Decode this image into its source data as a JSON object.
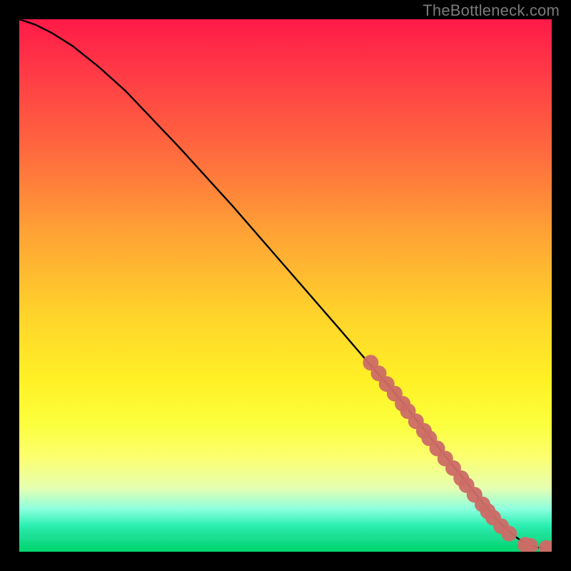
{
  "watermark": "TheBottleneck.com",
  "colors": {
    "page_bg": "#000000",
    "curve": "#000000",
    "marker_fill": "#cc6b66",
    "marker_stroke": "#cc6b66"
  },
  "chart_data": {
    "type": "line",
    "title": "",
    "xlabel": "",
    "ylabel": "",
    "xlim": [
      0,
      100
    ],
    "ylim": [
      0,
      100
    ],
    "grid": false,
    "legend": false,
    "series": [
      {
        "name": "curve",
        "x": [
          0,
          3,
          6,
          10,
          15,
          20,
          30,
          40,
          50,
          60,
          66,
          70,
          72,
          74,
          76,
          78,
          80,
          82,
          84,
          86,
          88,
          89,
          90,
          91.5,
          92.5,
          93.5,
          95,
          97,
          98,
          100
        ],
        "y": [
          100,
          99,
          97.5,
          95,
          91,
          86.5,
          76,
          65,
          53.5,
          42,
          35,
          30.5,
          28,
          25.5,
          23,
          20.5,
          18,
          15.5,
          13,
          10.5,
          8,
          6.8,
          5.6,
          4.3,
          3.4,
          2.6,
          1.6,
          0.9,
          0.7,
          0.6
        ]
      }
    ],
    "markers": [
      {
        "x": 66.0,
        "y": 35.5
      },
      {
        "x": 67.5,
        "y": 33.5
      },
      {
        "x": 69.0,
        "y": 31.5
      },
      {
        "x": 70.5,
        "y": 29.7
      },
      {
        "x": 72.0,
        "y": 27.8
      },
      {
        "x": 73.0,
        "y": 26.4
      },
      {
        "x": 74.5,
        "y": 24.5
      },
      {
        "x": 76.0,
        "y": 22.7
      },
      {
        "x": 77.0,
        "y": 21.3
      },
      {
        "x": 78.5,
        "y": 19.4
      },
      {
        "x": 80.0,
        "y": 17.5
      },
      {
        "x": 81.5,
        "y": 15.7
      },
      {
        "x": 83.0,
        "y": 13.8
      },
      {
        "x": 84.0,
        "y": 12.5
      },
      {
        "x": 85.5,
        "y": 10.7
      },
      {
        "x": 87.0,
        "y": 8.9
      },
      {
        "x": 88.0,
        "y": 7.6
      },
      {
        "x": 89.0,
        "y": 6.4
      },
      {
        "x": 90.5,
        "y": 4.8
      },
      {
        "x": 92.0,
        "y": 3.4
      },
      {
        "x": 95.0,
        "y": 1.3
      },
      {
        "x": 96.0,
        "y": 1.1
      },
      {
        "x": 99.0,
        "y": 0.7
      },
      {
        "x": 100.0,
        "y": 0.6
      }
    ]
  }
}
